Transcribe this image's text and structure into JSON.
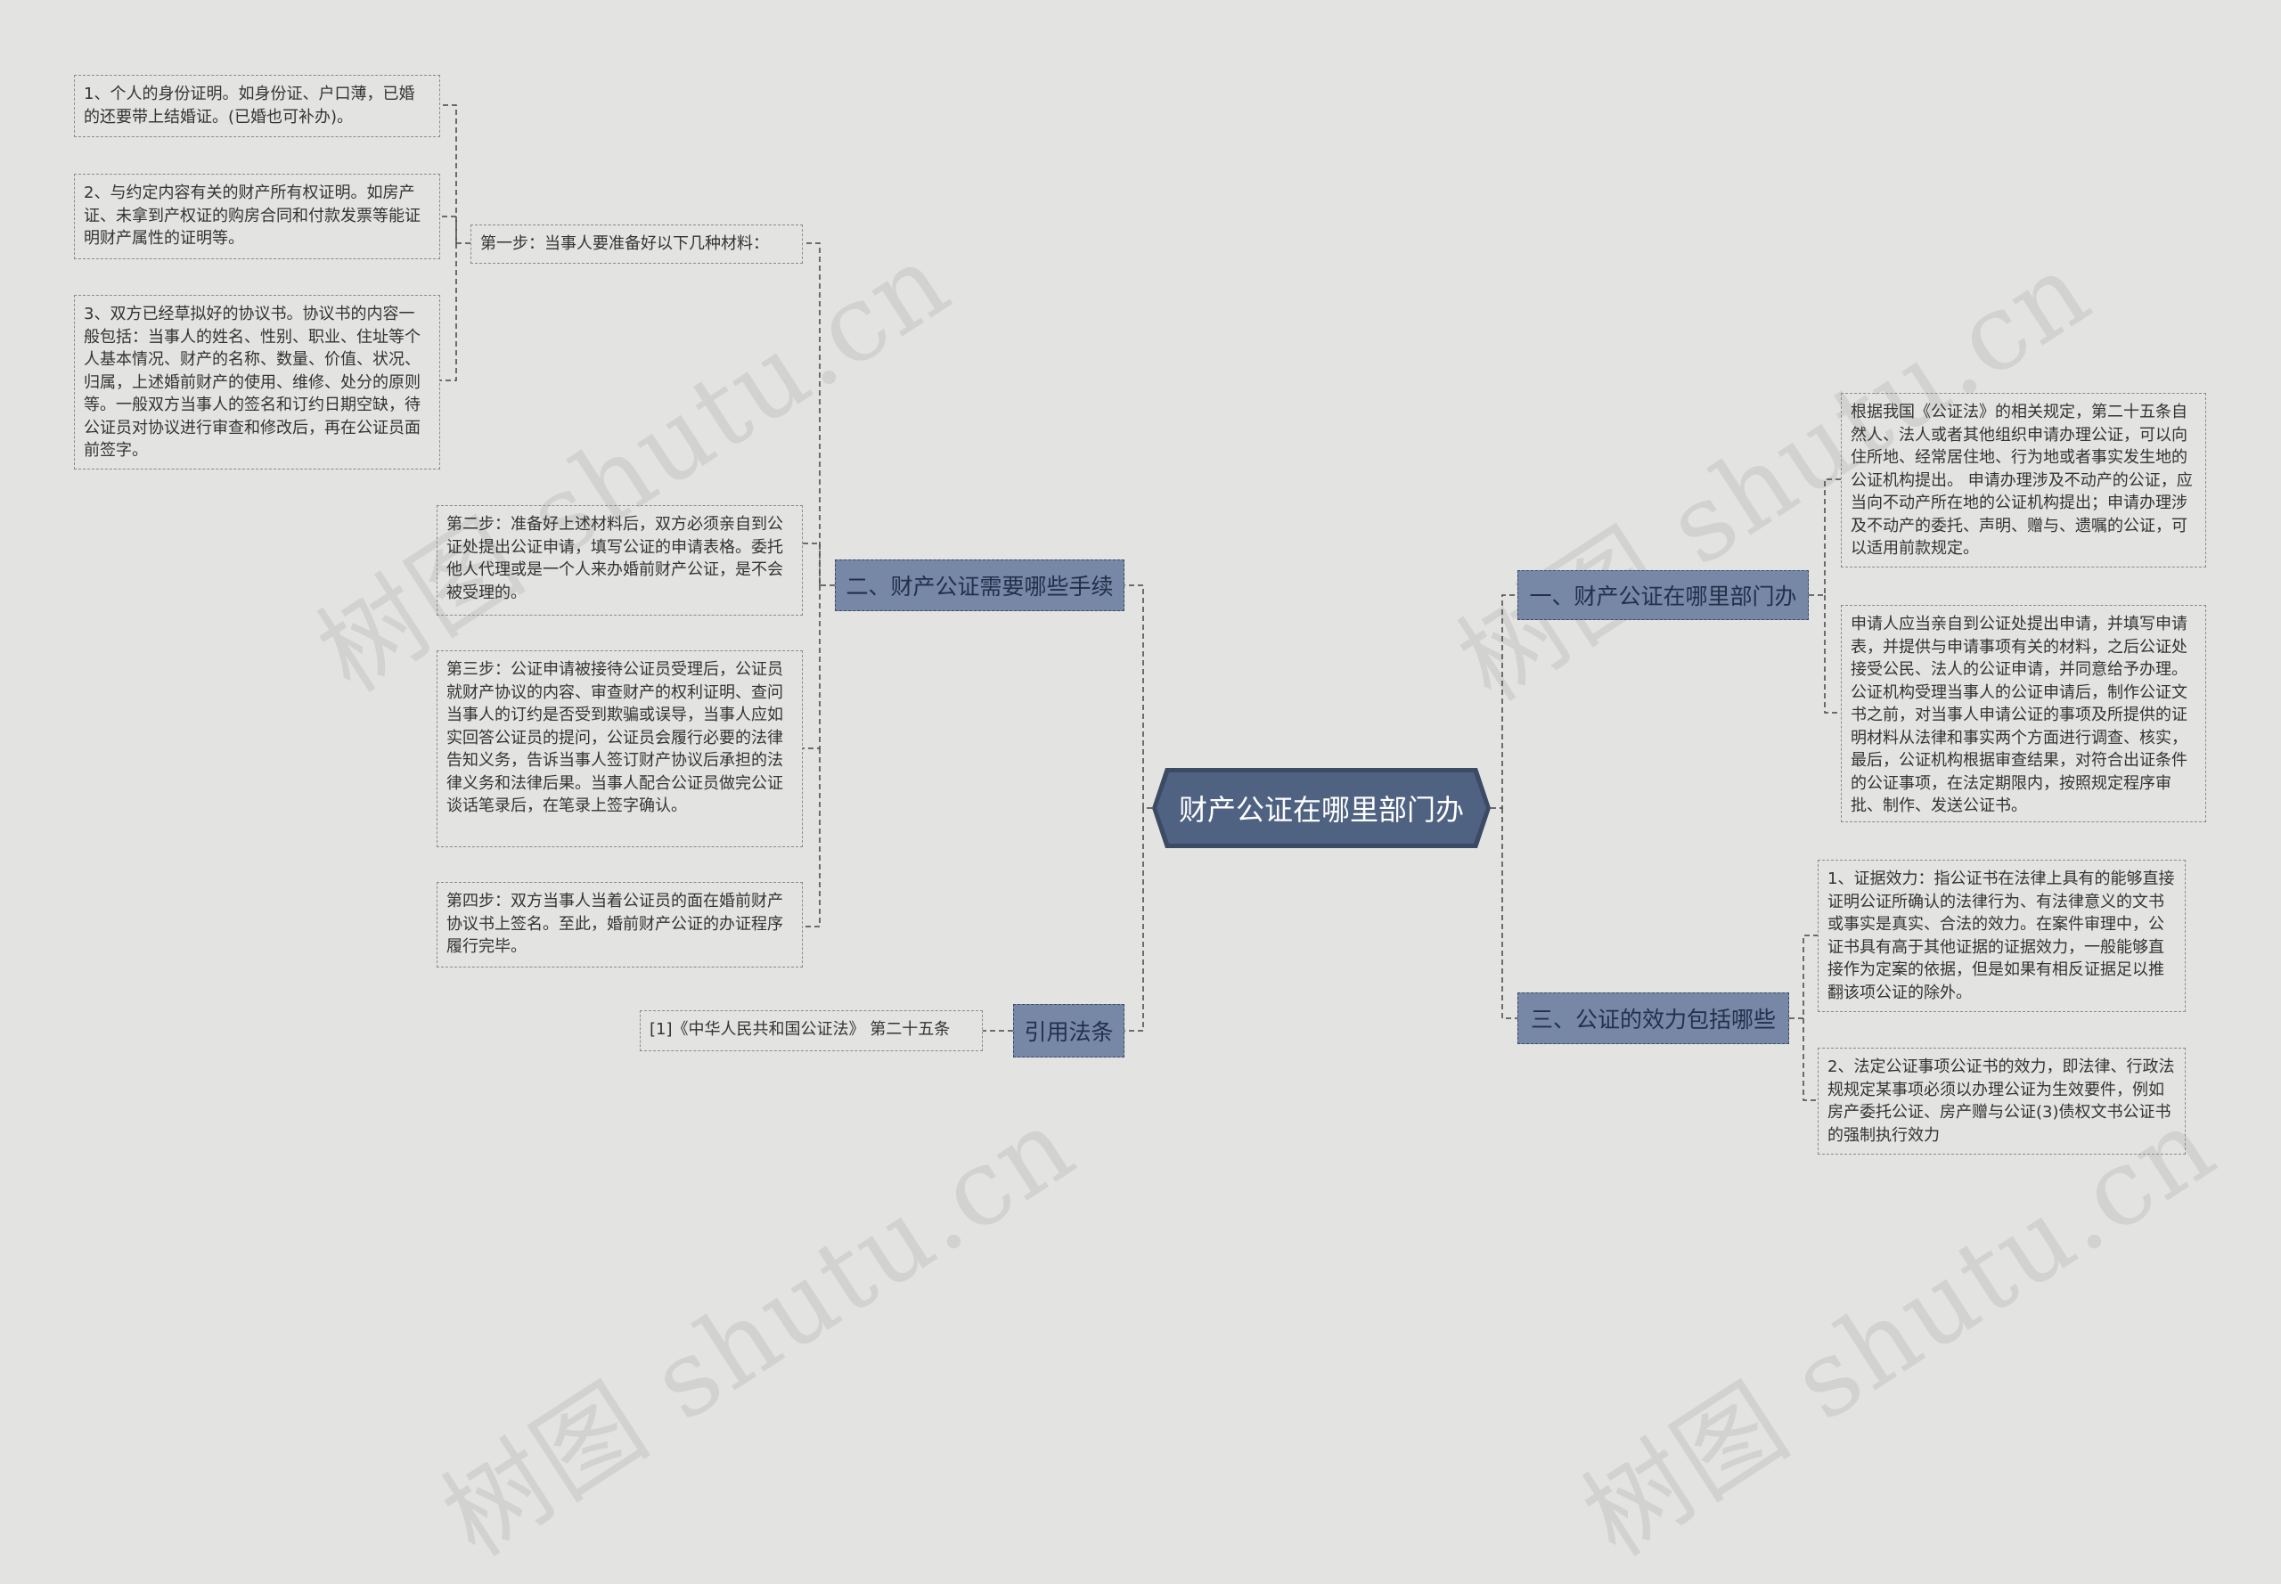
{
  "watermark": "树图 shutu.cn",
  "root": {
    "label": "财产公证在哪里部门办"
  },
  "branches": {
    "b1": {
      "label": "一、财产公证在哪里部门办"
    },
    "b2": {
      "label": "二、财产公证需要哪些手续"
    },
    "b3": {
      "label": "三、公证的效力包括哪些"
    },
    "b4": {
      "label": "引用法条"
    }
  },
  "b1_leaves": [
    "根据我国《公证法》的相关规定，第二十五条自然人、法人或者其他组织申请办理公证，可以向住所地、经常居住地、行为地或者事实发生地的公证机构提出。 申请办理涉及不动产的公证，应当向不动产所在地的公证机构提出；申请办理涉及不动产的委托、声明、赠与、遗嘱的公证，可以适用前款规定。",
    "申请人应当亲自到公证处提出申请，并填写申请表，并提供与申请事项有关的材料，之后公证处接受公民、法人的公证申请，并同意给予办理。公证机构受理当事人的公证申请后，制作公证文书之前，对当事人申请公证的事项及所提供的证明材料从法律和事实两个方面进行调查、核实，最后，公证机构根据审查结果，对符合出证条件的公证事项，在法定期限内，按照规定程序审批、制作、发送公证书。"
  ],
  "b2_steps": [
    "第一步：当事人要准备好以下几种材料：",
    "第二步：准备好上述材料后，双方必须亲自到公证处提出公证申请，填写公证的申请表格。委托他人代理或是一个人来办婚前财产公证，是不会被受理的。",
    "第三步：公证申请被接待公证员受理后，公证员就财产协议的内容、审查财产的权利证明、查问当事人的订约是否受到欺骗或误导，当事人应如实回答公证员的提问，公证员会履行必要的法律告知义务，告诉当事人签订财产协议后承担的法律义务和法律后果。当事人配合公证员做完公证谈话笔录后，在笔录上签字确认。",
    "第四步：双方当事人当着公证员的面在婚前财产协议书上签名。至此，婚前财产公证的办证程序履行完毕。"
  ],
  "b2_materials": [
    "1、个人的身份证明。如身份证、户口薄，已婚的还要带上结婚证。(已婚也可补办)。",
    "2、与约定内容有关的财产所有权证明。如房产证、未拿到产权证的购房合同和付款发票等能证明财产属性的证明等。",
    "3、双方已经草拟好的协议书。协议书的内容一般包括：当事人的姓名、性别、职业、住址等个人基本情况、财产的名称、数量、价值、状况、归属，上述婚前财产的使用、维修、处分的原则等。一般双方当事人的签名和订约日期空缺，待公证员对协议进行审查和修改后，再在公证员面前签字。"
  ],
  "b3_leaves": [
    "1、证据效力：指公证书在法律上具有的能够直接证明公证所确认的法律行为、有法律意义的文书或事实是真实、合法的效力。在案件审理中，公证书具有高于其他证据的证据效力，一般能够直接作为定案的依据，但是如果有相反证据足以推翻该项公证的除外。",
    "2、法定公证事项公证书的效力，即法律、行政法规规定某事项必须以办理公证为生效要件，例如房产委托公证、房产赠与公证(3)债权文书公证书的强制执行效力"
  ],
  "b4_leaves": [
    "[1]《中华人民共和国公证法》 第二十五条"
  ]
}
